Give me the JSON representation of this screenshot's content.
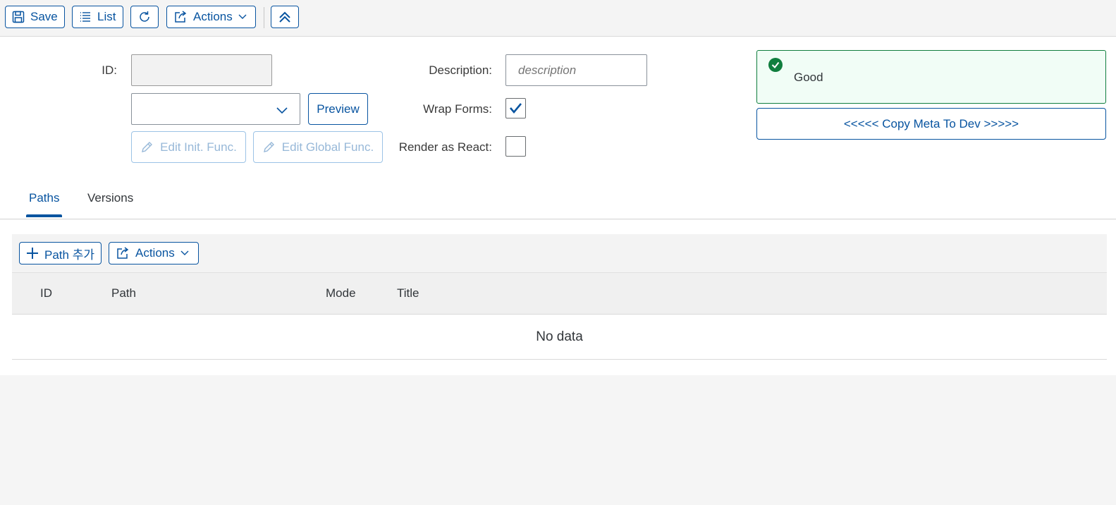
{
  "toolbar": {
    "save_label": "Save",
    "list_label": "List",
    "actions_label": "Actions"
  },
  "form": {
    "id_label": "ID:",
    "id_value": "",
    "description_label": "Description:",
    "description_placeholder": "description",
    "select_value": "",
    "preview_label": "Preview",
    "edit_init_label": "Edit Init. Func.",
    "edit_global_label": "Edit Global Func.",
    "wrap_forms_label": "Wrap Forms:",
    "wrap_forms_checked": true,
    "render_react_label": "Render as React:",
    "render_react_checked": false
  },
  "status": {
    "message": "Good",
    "copy_button_label": "<<<<< Copy Meta To Dev >>>>>"
  },
  "tabs": [
    {
      "label": "Paths",
      "active": true
    },
    {
      "label": "Versions",
      "active": false
    }
  ],
  "table": {
    "add_path_label": "Path 추가",
    "actions_label": "Actions",
    "columns": [
      "ID",
      "Path",
      "Mode",
      "Title"
    ],
    "empty_text": "No data"
  },
  "colors": {
    "accent": "#0854a0",
    "success": "#107e3e",
    "success_bg": "#f1fdf6"
  },
  "icons": {
    "save": "save-icon",
    "list": "list-icon",
    "refresh": "refresh-icon",
    "share": "share-icon",
    "collapse": "collapse-up-icon",
    "edit": "pencil-icon",
    "check": "checkmark-icon",
    "add": "add-icon"
  }
}
